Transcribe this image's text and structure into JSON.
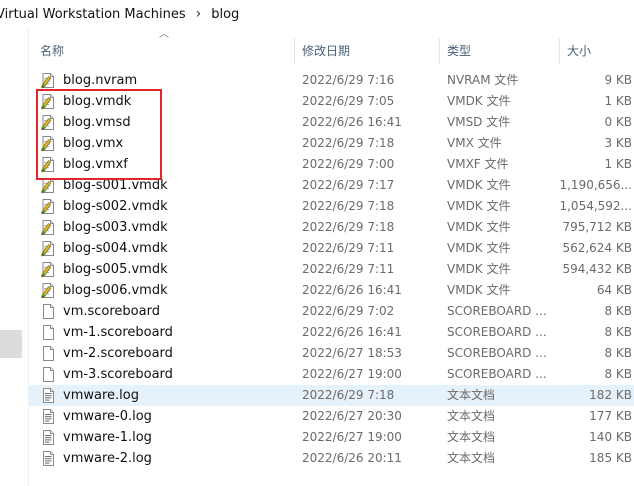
{
  "breadcrumb": {
    "items": [
      "Virtual Workstation Machines",
      "blog"
    ],
    "separator": "›"
  },
  "columns": {
    "name": "名称",
    "date": "修改日期",
    "type": "类型",
    "size": "大小"
  },
  "files": [
    {
      "name": "blog.nvram",
      "date": "2022/6/29 7:16",
      "type": "NVRAM 文件",
      "size": "9 KB",
      "icon": "vm-file-icon"
    },
    {
      "name": "blog.vmdk",
      "date": "2022/6/29 7:05",
      "type": "VMDK 文件",
      "size": "1 KB",
      "icon": "vm-file-icon"
    },
    {
      "name": "blog.vmsd",
      "date": "2022/6/26 16:41",
      "type": "VMSD 文件",
      "size": "0 KB",
      "icon": "vm-file-icon"
    },
    {
      "name": "blog.vmx",
      "date": "2022/6/29 7:18",
      "type": "VMX 文件",
      "size": "3 KB",
      "icon": "vm-file-icon"
    },
    {
      "name": "blog.vmxf",
      "date": "2022/6/29 7:00",
      "type": "VMXF 文件",
      "size": "1 KB",
      "icon": "vm-file-icon"
    },
    {
      "name": "blog-s001.vmdk",
      "date": "2022/6/29 7:17",
      "type": "VMDK 文件",
      "size": "1,190,656...",
      "icon": "vm-file-icon"
    },
    {
      "name": "blog-s002.vmdk",
      "date": "2022/6/29 7:18",
      "type": "VMDK 文件",
      "size": "1,054,592...",
      "icon": "vm-file-icon"
    },
    {
      "name": "blog-s003.vmdk",
      "date": "2022/6/29 7:18",
      "type": "VMDK 文件",
      "size": "795,712 KB",
      "icon": "vm-file-icon"
    },
    {
      "name": "blog-s004.vmdk",
      "date": "2022/6/29 7:11",
      "type": "VMDK 文件",
      "size": "562,624 KB",
      "icon": "vm-file-icon"
    },
    {
      "name": "blog-s005.vmdk",
      "date": "2022/6/29 7:11",
      "type": "VMDK 文件",
      "size": "594,432 KB",
      "icon": "vm-file-icon"
    },
    {
      "name": "blog-s006.vmdk",
      "date": "2022/6/26 16:41",
      "type": "VMDK 文件",
      "size": "64 KB",
      "icon": "vm-file-icon"
    },
    {
      "name": "vm.scoreboard",
      "date": "2022/6/29 7:02",
      "type": "SCOREBOARD ...",
      "size": "8 KB",
      "icon": "blank-file-icon"
    },
    {
      "name": "vm-1.scoreboard",
      "date": "2022/6/26 16:41",
      "type": "SCOREBOARD ...",
      "size": "8 KB",
      "icon": "blank-file-icon"
    },
    {
      "name": "vm-2.scoreboard",
      "date": "2022/6/27 18:53",
      "type": "SCOREBOARD ...",
      "size": "8 KB",
      "icon": "blank-file-icon"
    },
    {
      "name": "vm-3.scoreboard",
      "date": "2022/6/27 19:00",
      "type": "SCOREBOARD ...",
      "size": "8 KB",
      "icon": "blank-file-icon"
    },
    {
      "name": "vmware.log",
      "date": "2022/6/29 7:18",
      "type": "文本文档",
      "size": "182 KB",
      "icon": "text-file-icon",
      "selected": true
    },
    {
      "name": "vmware-0.log",
      "date": "2022/6/27 20:30",
      "type": "文本文档",
      "size": "177 KB",
      "icon": "text-file-icon"
    },
    {
      "name": "vmware-1.log",
      "date": "2022/6/27 19:00",
      "type": "文本文档",
      "size": "140 KB",
      "icon": "text-file-icon"
    },
    {
      "name": "vmware-2.log",
      "date": "2022/6/26 20:11",
      "type": "文本文档",
      "size": "185 KB",
      "icon": "text-file-icon"
    }
  ],
  "colors": {
    "highlight_box": "#e0262b",
    "selected_row": "#e5f1fb",
    "header_text": "#4c607a",
    "secondary_text": "#6b6b6b"
  }
}
